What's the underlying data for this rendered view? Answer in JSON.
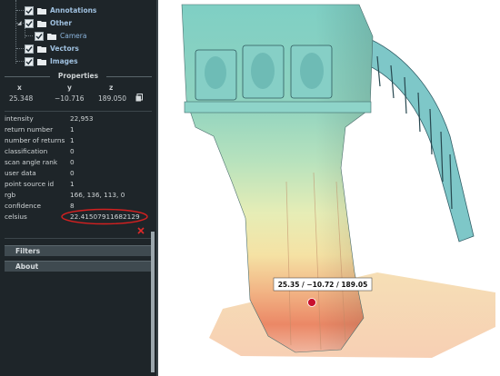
{
  "tree": {
    "items": [
      {
        "label": "Annotations",
        "level": 0,
        "checked": true
      },
      {
        "label": "Other",
        "level": 0,
        "checked": true
      },
      {
        "label": "Camera",
        "level": 1,
        "checked": true
      },
      {
        "label": "Vectors",
        "level": 0,
        "checked": true
      },
      {
        "label": "Images",
        "level": 0,
        "checked": true
      }
    ]
  },
  "properties": {
    "title": "Properties",
    "coords": {
      "headers": [
        "x",
        "y",
        "z"
      ],
      "values": [
        "25.348",
        "−10.716",
        "189.050"
      ]
    },
    "attributes": [
      {
        "name": "intensity",
        "value": "22,953"
      },
      {
        "name": "return number",
        "value": "1"
      },
      {
        "name": "number of returns",
        "value": "1"
      },
      {
        "name": "classification",
        "value": "0"
      },
      {
        "name": "scan angle rank",
        "value": "0"
      },
      {
        "name": "user data",
        "value": "0"
      },
      {
        "name": "point source id",
        "value": "1"
      },
      {
        "name": "rgb",
        "value": "166, 136, 113, 0"
      },
      {
        "name": "confidence",
        "value": "8"
      },
      {
        "name": "celsius",
        "value": "22.41507911682129"
      }
    ]
  },
  "panels": {
    "filters": "Filters",
    "about": "About"
  },
  "viewport": {
    "measurement_label": "25.35 / −10.72 / 189.05"
  },
  "colors": {
    "sidebar_bg": "#1e2529",
    "highlight_ellipse": "#d42020",
    "delete_icon": "#e02a2a",
    "marker": "#c8102e"
  }
}
